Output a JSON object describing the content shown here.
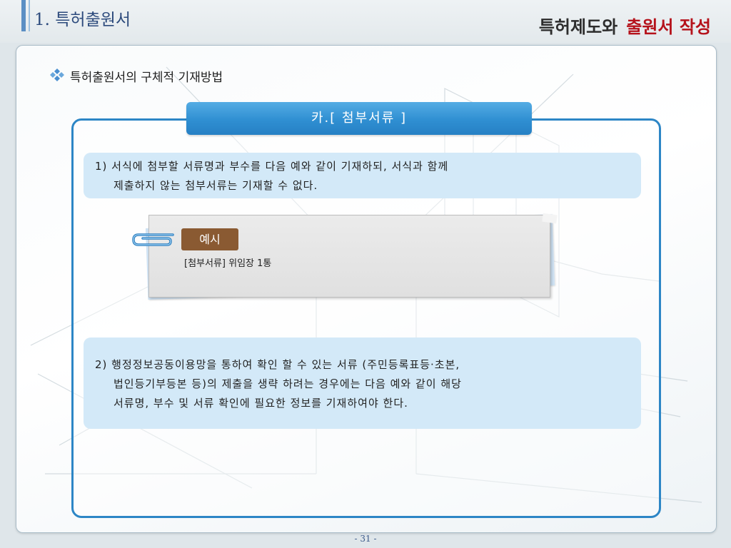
{
  "header": {
    "section_title": "1. 특허출원서",
    "title_part1": "특허제도와",
    "title_part2": "출원서 작성"
  },
  "subtitle": "특허출원서의 구체적 기재방법",
  "box_title": "카.[ 첨부서류 ]",
  "item1": {
    "line1": "1) 서식에 첨부할 서류명과 부수를 다음 예와 같이 기재하되, 서식과 함께",
    "line2": "제출하지 않는 첨부서류는 기재할 수 없다."
  },
  "example": {
    "badge": "예시",
    "text": "[첨부서류] 위임장 1통"
  },
  "item2": {
    "line1": "2) 행정정보공동이용망을 통하여 확인 할 수 있는 서류 (주민등록표등·초본,",
    "line2": "법인등기부등본 등)의 제출을 생략 하려는 경우에는 다음 예와 같이 해당",
    "line3": "서류명, 부수 및 서류 확인에 필요한 정보를 기재하여야 한다."
  },
  "page_number": "- 31 -",
  "colors": {
    "accent_blue": "#2d86c6",
    "title_red": "#b5121b",
    "info_box": "#d3e9f8",
    "badge_brown": "#8a5a32"
  }
}
